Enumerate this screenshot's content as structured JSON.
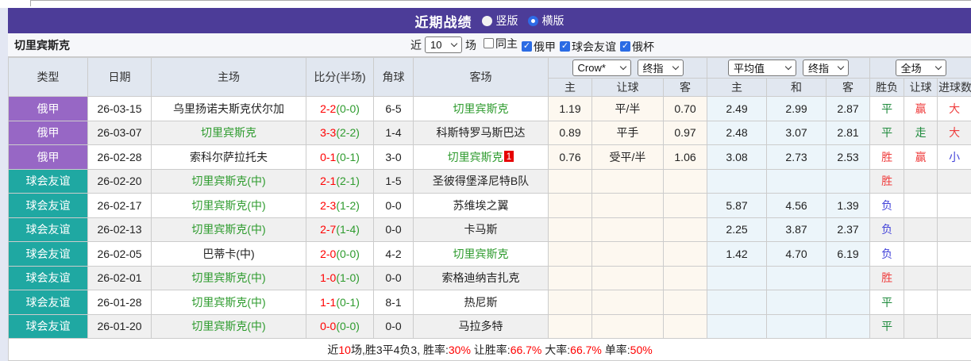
{
  "colors": {
    "title_bar_bg": "#4c3c98",
    "league_badge": {
      "俄甲": "#9767c5",
      "球会友谊": "#1fa8a2"
    },
    "score_red": "#ff0000",
    "focus_team_green": "#2e9b2e",
    "result_red": "#ef3e3e",
    "result_green": "#1e8a3c",
    "result_blue": "#4343d9",
    "rank_badge_red": "#e60000"
  },
  "title_bar": {
    "title": "近期战绩",
    "radios": [
      {
        "label": "竖版",
        "selected": false
      },
      {
        "label": "横版",
        "selected": true
      }
    ]
  },
  "filter_bar": {
    "team_name": "切里宾斯克",
    "near_label": "近",
    "match_count": "10",
    "unit_label": "场",
    "filters": [
      {
        "label": "同主",
        "checked": false
      },
      {
        "label": "俄甲",
        "checked": true
      },
      {
        "label": "球会友谊",
        "checked": true
      },
      {
        "label": "俄杯",
        "checked": true
      }
    ]
  },
  "table": {
    "dropdowns": {
      "bookmaker": "Crow*",
      "bookmaker_final": "终指",
      "average": "平均值",
      "average_final": "终指",
      "scope": "全场"
    },
    "headers": {
      "type": "类型",
      "date": "日期",
      "home": "主场",
      "score": "比分(半场)",
      "corner": "角球",
      "away": "客场"
    },
    "sub_headers": [
      "主",
      "让球",
      "客",
      "主",
      "和",
      "客",
      "胜负",
      "让球",
      "进球数"
    ],
    "rows": [
      {
        "league": "俄甲",
        "date": "26-03-15",
        "home": "乌里扬诺夫斯克伏尔加",
        "home_is_focus": false,
        "ft": "2-2",
        "ht": "(0-0)",
        "corner": "6-5",
        "away": "切里宾斯克",
        "away_is_focus": true,
        "away_badge": "",
        "odds": [
          "1.19",
          "平/半",
          "0.70"
        ],
        "avg": [
          "2.49",
          "2.99",
          "2.87"
        ],
        "result": "平",
        "result_color": "green",
        "handicap": "赢",
        "handicap_color": "red",
        "goals": "大",
        "goals_color": "red"
      },
      {
        "league": "俄甲",
        "date": "26-03-07",
        "home": "切里宾斯克",
        "home_is_focus": true,
        "ft": "3-3",
        "ht": "(2-2)",
        "corner": "1-4",
        "away": "科斯特罗马斯巴达",
        "away_is_focus": false,
        "away_badge": "",
        "odds": [
          "0.89",
          "平手",
          "0.97"
        ],
        "avg": [
          "2.48",
          "3.07",
          "2.81"
        ],
        "result": "平",
        "result_color": "green",
        "handicap": "走",
        "handicap_color": "green",
        "goals": "大",
        "goals_color": "red"
      },
      {
        "league": "俄甲",
        "date": "26-02-28",
        "home": "索科尔萨拉托夫",
        "home_is_focus": false,
        "ft": "0-1",
        "ht": "(0-1)",
        "corner": "3-0",
        "away": "切里宾斯克",
        "away_is_focus": true,
        "away_badge": "1",
        "odds": [
          "0.76",
          "受平/半",
          "1.06"
        ],
        "avg": [
          "3.08",
          "2.73",
          "2.53"
        ],
        "result": "胜",
        "result_color": "red",
        "handicap": "赢",
        "handicap_color": "red",
        "goals": "小",
        "goals_color": "blue"
      },
      {
        "league": "球会友谊",
        "date": "26-02-20",
        "home": "切里宾斯克(中)",
        "home_is_focus": true,
        "ft": "2-1",
        "ht": "(2-1)",
        "corner": "1-5",
        "away": "圣彼得堡泽尼特B队",
        "away_is_focus": false,
        "away_badge": "",
        "odds": [
          "",
          "",
          ""
        ],
        "avg": [
          "",
          "",
          ""
        ],
        "result": "胜",
        "result_color": "red",
        "handicap": "",
        "handicap_color": "",
        "goals": "",
        "goals_color": ""
      },
      {
        "league": "球会友谊",
        "date": "26-02-17",
        "home": "切里宾斯克(中)",
        "home_is_focus": true,
        "ft": "2-3",
        "ht": "(1-2)",
        "corner": "0-0",
        "away": "苏维埃之翼",
        "away_is_focus": false,
        "away_badge": "",
        "odds": [
          "",
          "",
          ""
        ],
        "avg": [
          "5.87",
          "4.56",
          "1.39"
        ],
        "result": "负",
        "result_color": "blue",
        "handicap": "",
        "handicap_color": "",
        "goals": "",
        "goals_color": ""
      },
      {
        "league": "球会友谊",
        "date": "26-02-13",
        "home": "切里宾斯克(中)",
        "home_is_focus": true,
        "ft": "2-7",
        "ht": "(1-4)",
        "corner": "0-0",
        "away": "卡马斯",
        "away_is_focus": false,
        "away_badge": "",
        "odds": [
          "",
          "",
          ""
        ],
        "avg": [
          "2.25",
          "3.87",
          "2.37"
        ],
        "result": "负",
        "result_color": "blue",
        "handicap": "",
        "handicap_color": "",
        "goals": "",
        "goals_color": ""
      },
      {
        "league": "球会友谊",
        "date": "26-02-05",
        "home": "巴蒂卡(中)",
        "home_is_focus": false,
        "ft": "2-0",
        "ht": "(0-0)",
        "corner": "4-2",
        "away": "切里宾斯克",
        "away_is_focus": true,
        "away_badge": "",
        "odds": [
          "",
          "",
          ""
        ],
        "avg": [
          "1.42",
          "4.70",
          "6.19"
        ],
        "result": "负",
        "result_color": "blue",
        "handicap": "",
        "handicap_color": "",
        "goals": "",
        "goals_color": ""
      },
      {
        "league": "球会友谊",
        "date": "26-02-01",
        "home": "切里宾斯克(中)",
        "home_is_focus": true,
        "ft": "1-0",
        "ht": "(1-0)",
        "corner": "0-0",
        "away": "索格迪纳吉扎克",
        "away_is_focus": false,
        "away_badge": "",
        "odds": [
          "",
          "",
          ""
        ],
        "avg": [
          "",
          "",
          ""
        ],
        "result": "胜",
        "result_color": "red",
        "handicap": "",
        "handicap_color": "",
        "goals": "",
        "goals_color": ""
      },
      {
        "league": "球会友谊",
        "date": "26-01-28",
        "home": "切里宾斯克(中)",
        "home_is_focus": true,
        "ft": "1-1",
        "ht": "(0-1)",
        "corner": "8-1",
        "away": "热尼斯",
        "away_is_focus": false,
        "away_badge": "",
        "odds": [
          "",
          "",
          ""
        ],
        "avg": [
          "",
          "",
          ""
        ],
        "result": "平",
        "result_color": "green",
        "handicap": "",
        "handicap_color": "",
        "goals": "",
        "goals_color": ""
      },
      {
        "league": "球会友谊",
        "date": "26-01-20",
        "home": "切里宾斯克(中)",
        "home_is_focus": true,
        "ft": "0-0",
        "ht": "(0-0)",
        "corner": "0-0",
        "away": "马拉多特",
        "away_is_focus": false,
        "away_badge": "",
        "odds": [
          "",
          "",
          ""
        ],
        "avg": [
          "",
          "",
          ""
        ],
        "result": "平",
        "result_color": "green",
        "handicap": "",
        "handicap_color": "",
        "goals": "",
        "goals_color": ""
      }
    ]
  },
  "footer": {
    "segments": [
      {
        "text": "近"
      },
      {
        "text": "10",
        "red": true
      },
      {
        "text": "场,胜3平4负3, 胜率:"
      },
      {
        "text": "30%",
        "red": true
      },
      {
        "text": " 让胜率:"
      },
      {
        "text": "66.7%",
        "red": true
      },
      {
        "text": " 大率:"
      },
      {
        "text": "66.7%",
        "red": true
      },
      {
        "text": " 单率:"
      },
      {
        "text": "50%",
        "red": true
      }
    ]
  }
}
